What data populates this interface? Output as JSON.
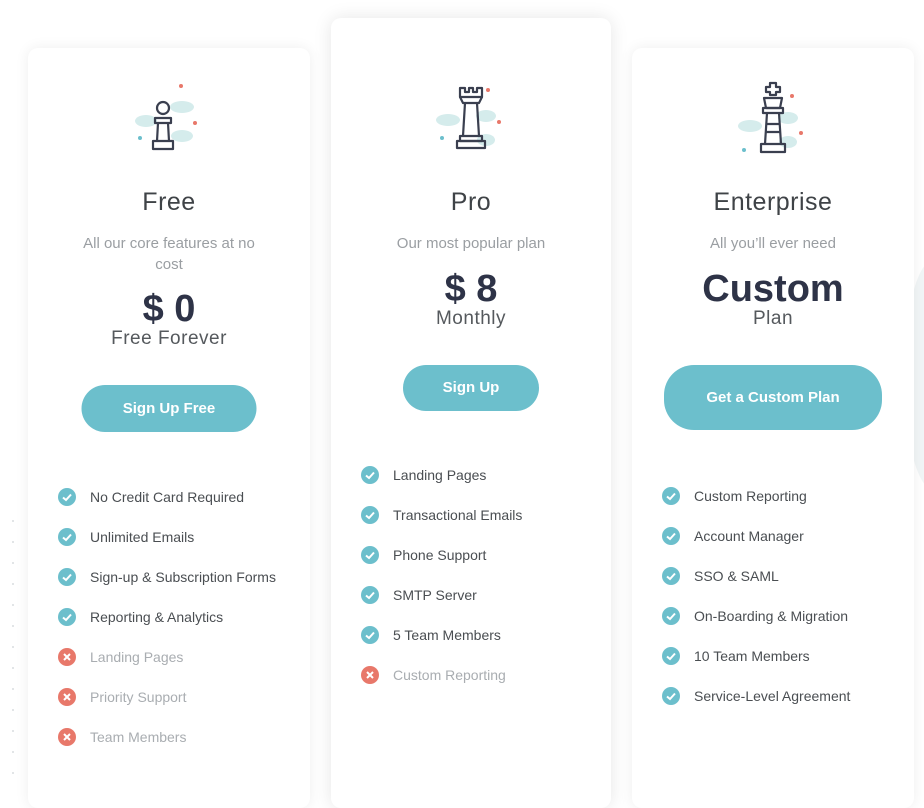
{
  "accent_color": "#6cbfcc",
  "negative_color": "#e8786a",
  "plans": [
    {
      "id": "free",
      "icon": "chess-pawn-icon",
      "name": "Free",
      "tagline": "All our core features at no cost",
      "price": "$ 0",
      "period": "Free Forever",
      "cta": "Sign Up Free",
      "features": [
        {
          "label": "No Credit Card Required",
          "included": true
        },
        {
          "label": "Unlimited Emails",
          "included": true
        },
        {
          "label": "Sign-up & Subscription Forms",
          "included": true
        },
        {
          "label": "Reporting & Analytics",
          "included": true
        },
        {
          "label": "Landing Pages",
          "included": false
        },
        {
          "label": "Priority Support",
          "included": false
        },
        {
          "label": "Team Members",
          "included": false
        }
      ]
    },
    {
      "id": "pro",
      "icon": "chess-rook-icon",
      "name": "Pro",
      "tagline": "Our most popular plan",
      "price": "$ 8",
      "period": "Monthly",
      "cta": "Sign Up",
      "features": [
        {
          "label": "Landing Pages",
          "included": true
        },
        {
          "label": "Transactional Emails",
          "included": true
        },
        {
          "label": "Phone Support",
          "included": true
        },
        {
          "label": "SMTP Server",
          "included": true
        },
        {
          "label": "5 Team Members",
          "included": true
        },
        {
          "label": "Custom Reporting",
          "included": false
        }
      ]
    },
    {
      "id": "enterprise",
      "icon": "chess-king-icon",
      "name": "Enterprise",
      "tagline": "All you’ll ever need",
      "price": "Custom",
      "period": "Plan",
      "cta": "Get a Custom Plan",
      "features": [
        {
          "label": "Custom Reporting",
          "included": true
        },
        {
          "label": "Account Manager",
          "included": true
        },
        {
          "label": "SSO & SAML",
          "included": true
        },
        {
          "label": "On-Boarding & Migration",
          "included": true
        },
        {
          "label": "10 Team Members",
          "included": true
        },
        {
          "label": "Service-Level Agreement",
          "included": true
        }
      ]
    }
  ]
}
